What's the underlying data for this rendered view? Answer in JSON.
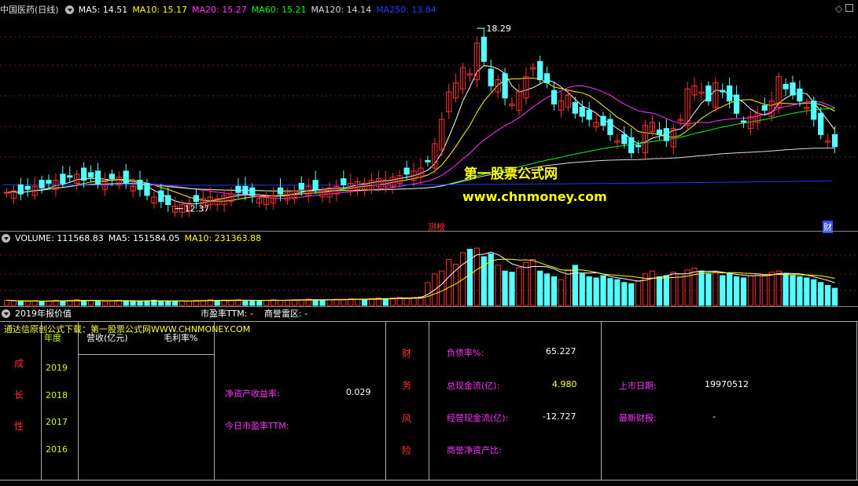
{
  "main_header": {
    "title": "中国医药(日线)",
    "ma5": "MA5: 14.51",
    "ma10": "MA10: 15.17",
    "ma20": "MA20: 15.27",
    "ma60": "MA60: 15.21",
    "ma120": "MA120: 14.14",
    "ma250": "MA250: 13.84",
    "colors": {
      "ma5": "#ffffff",
      "ma10": "#ffff00",
      "ma20": "#ff33ff",
      "ma60": "#00ff00",
      "ma120": "#dddddd",
      "ma250": "#1a3cff"
    }
  },
  "price_chart": {
    "high_label": "18.29",
    "low_label": "12.37",
    "marker_left": "测榜",
    "marker_right": "财",
    "up_color": "#ff3030",
    "down_color": "#54ffff"
  },
  "watermark": {
    "line1": "第一股票公式网",
    "line2": "www.chnmoney.com"
  },
  "volume_header": {
    "volume": "VOLUME: 111568.83",
    "ma5": "MA5: 151584.05",
    "ma10": "MA10: 231363.88"
  },
  "report_header": {
    "title": "2019年报价值",
    "pe_ttm": "市盈率TTM: -",
    "goodwill": "商誉雷区: -"
  },
  "panel": {
    "source_line": "通达信原创公式下载：第一股票公式网WWW.CHNMONEY.COM",
    "growth_label": [
      "成",
      "长",
      "性"
    ],
    "col_year": "年度",
    "col_revenue": "营收(亿元)",
    "col_margin": "毛利率%",
    "years": [
      "2019",
      "2018",
      "2017",
      "2016"
    ],
    "roe_label": "净资产收益率:",
    "roe_value": "0.029",
    "pe_today_label": "今日市盈率TTM:",
    "finance_risk_label": [
      "财",
      "务",
      "风",
      "险"
    ],
    "debt_ratio_label": "负债率%:",
    "debt_ratio_value": "65.227",
    "total_cashflow_label": "总现金流(亿):",
    "total_cashflow_value": "4.980",
    "op_cashflow_label": "经营现金流(亿):",
    "op_cashflow_value": "-12.727",
    "goodwill_ratio_label": "商誉净资产比:",
    "listing_date_label": "上市日期:",
    "listing_date_value": "19970512",
    "latest_report_label": "最新财报:",
    "latest_report_value": "-"
  },
  "chart_data": {
    "type": "candlestick",
    "series_note": "",
    "closes": [
      12.9,
      12.95,
      12.85,
      13.0,
      13.1,
      13.05,
      13.2,
      13.3,
      13.2,
      13.4,
      13.5,
      13.3,
      13.4,
      13.2,
      13.25,
      13.35,
      13.4,
      13.2,
      13.1,
      13.0,
      12.8,
      12.75,
      12.6,
      12.5,
      12.45,
      12.5,
      12.55,
      12.6,
      12.7,
      12.75,
      12.7,
      12.8,
      12.85,
      12.9,
      12.85,
      12.8,
      12.7,
      12.75,
      12.8,
      12.85,
      12.9,
      12.95,
      13.0,
      13.1,
      13.0,
      12.95,
      13.05,
      13.1,
      13.15,
      13.2,
      13.25,
      13.2,
      13.3,
      13.35,
      13.3,
      13.4,
      13.45,
      13.5,
      13.6,
      13.7,
      13.9,
      14.5,
      15.3,
      16.2,
      16.5,
      17.0,
      16.8,
      17.8,
      17.2,
      16.4,
      16.6,
      16.0,
      15.8,
      16.2,
      16.7,
      17.0,
      16.6,
      16.5,
      15.8,
      15.9,
      16.1,
      15.5,
      15.4,
      15.3,
      15.2,
      15.1,
      14.8,
      14.6,
      14.5,
      14.2,
      14.4,
      15.1,
      15.2,
      14.8,
      14.6,
      15.0,
      15.3,
      16.3,
      16.4,
      16.2,
      15.9,
      16.5,
      16.2,
      15.9,
      15.5,
      15.2,
      15.4,
      15.5,
      15.6,
      15.9,
      16.7,
      16.3,
      16.1,
      15.9,
      15.7,
      15.3,
      14.8,
      14.6,
      14.4
    ],
    "volumes": [
      9,
      8,
      7,
      7,
      8,
      7,
      8,
      9,
      8,
      9,
      10,
      8,
      9,
      7,
      7,
      8,
      9,
      8,
      7,
      7,
      8,
      9,
      8,
      7,
      7,
      8,
      8,
      9,
      9,
      10,
      8,
      9,
      9,
      10,
      9,
      8,
      8,
      9,
      10,
      9,
      9,
      10,
      10,
      11,
      9,
      9,
      10,
      11,
      11,
      12,
      11,
      10,
      12,
      13,
      12,
      13,
      14,
      13,
      14,
      15,
      40,
      55,
      60,
      80,
      72,
      92,
      98,
      100,
      85,
      90,
      70,
      60,
      58,
      66,
      75,
      80,
      60,
      55,
      50,
      45,
      62,
      70,
      55,
      50,
      48,
      52,
      47,
      45,
      40,
      38,
      42,
      55,
      60,
      50,
      52,
      58,
      55,
      62,
      65,
      60,
      55,
      58,
      52,
      56,
      50,
      48,
      52,
      55,
      53,
      58,
      60,
      55,
      52,
      50,
      48,
      45,
      40,
      35,
      30
    ]
  }
}
